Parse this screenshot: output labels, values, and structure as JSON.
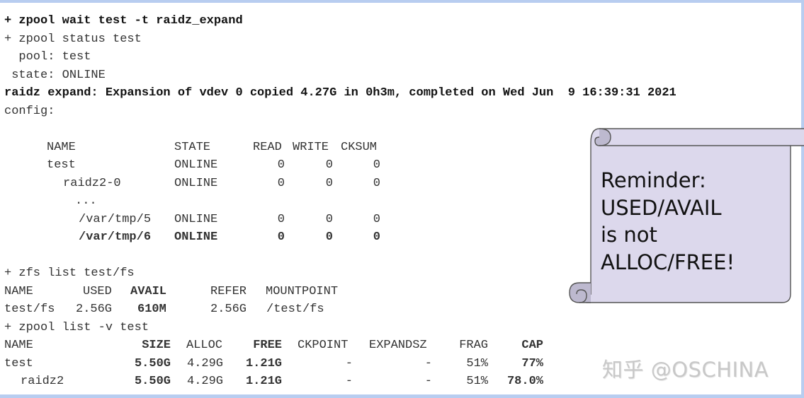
{
  "terminal": {
    "cmd_wait": "+ zpool wait test -t raidz_expand",
    "cmd_status": "+ zpool status test",
    "pool_line": "  pool: test",
    "state_line": " state: ONLINE",
    "expand_line": "raidz expand: Expansion of vdev 0 copied 4.27G in 0h3m, completed on Wed Jun  9 16:39:31 2021",
    "config_line": "config:",
    "config_table": {
      "headers": [
        "NAME",
        "STATE",
        "READ",
        "WRITE",
        "CKSUM"
      ],
      "rows": [
        {
          "name": "test",
          "state": "ONLINE",
          "read": "0",
          "write": "0",
          "cksum": "0",
          "bold": false
        },
        {
          "name": "raidz2-0",
          "state": "ONLINE",
          "read": "0",
          "write": "0",
          "cksum": "0",
          "bold": false
        },
        {
          "name": "...",
          "state": "",
          "read": "",
          "write": "",
          "cksum": "",
          "bold": false
        },
        {
          "name": "/var/tmp/5",
          "state": "ONLINE",
          "read": "0",
          "write": "0",
          "cksum": "0",
          "bold": false
        },
        {
          "name": "/var/tmp/6",
          "state": "ONLINE",
          "read": "0",
          "write": "0",
          "cksum": "0",
          "bold": true
        }
      ]
    },
    "cmd_zfs_list": "+ zfs list test/fs",
    "zfs_table": {
      "headers": [
        "NAME",
        "USED",
        "AVAIL",
        "REFER",
        "MOUNTPOINT"
      ],
      "rows": [
        {
          "name": "test/fs",
          "used": "2.56G",
          "avail": "610M",
          "refer": "2.56G",
          "mountpoint": "/test/fs"
        }
      ]
    },
    "cmd_zpool_list": "+ zpool list -v test",
    "zpool_table": {
      "headers": [
        "NAME",
        "SIZE",
        "ALLOC",
        "FREE",
        "CKPOINT",
        "EXPANDSZ",
        "FRAG",
        "CAP"
      ],
      "rows": [
        {
          "name": "test",
          "size": "5.50G",
          "alloc": "4.29G",
          "free": "1.21G",
          "ckpoint": "-",
          "expandsz": "-",
          "frag": "51%",
          "cap": "77%"
        },
        {
          "name": "raidz2",
          "size": "5.50G",
          "alloc": "4.29G",
          "free": "1.21G",
          "ckpoint": "-",
          "expandsz": "-",
          "frag": "51%",
          "cap": "78.0%"
        }
      ]
    }
  },
  "callout": {
    "lines": [
      "Reminder:",
      "USED/AVAIL",
      "is not",
      "ALLOC/FREE!"
    ],
    "fill_color": "#dcd8ec",
    "border_color": "#555555"
  },
  "watermark": "知乎 @OSCHINA",
  "colors": {
    "frame_border": "#b8cdf0"
  }
}
